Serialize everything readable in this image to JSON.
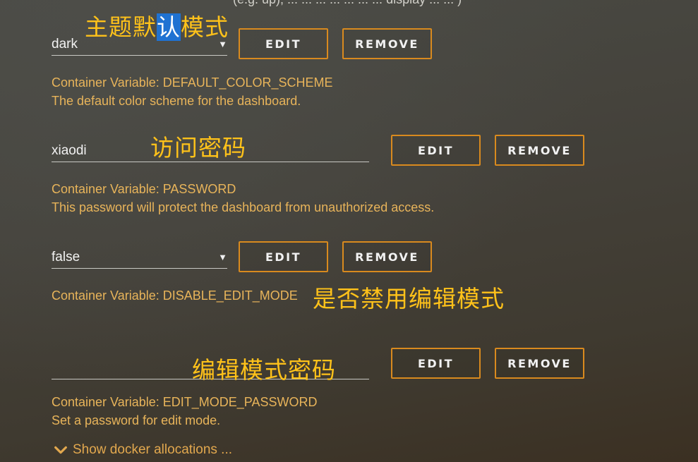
{
  "top_clipped_text": "(e.g. up), ... ... ... ... ... ... ... display ... ... )",
  "annotations": {
    "theme_prefix": "主题默",
    "theme_highlight": "认",
    "theme_suffix": "模式",
    "password": "访问密码",
    "disable_edit": "是否禁用编辑模式",
    "edit_password": "编辑模式密码"
  },
  "rows": [
    {
      "value": "dark",
      "caret": "▼",
      "edit_label": "EDIT",
      "remove_label": "REMOVE",
      "container_variable": "Container Variable: DEFAULT_COLOR_SCHEME",
      "description": "The default color scheme for the dashboard."
    },
    {
      "value": "xiaodi",
      "edit_label": "EDIT",
      "remove_label": "REMOVE",
      "container_variable": "Container Variable: PASSWORD",
      "description": "This password will protect the dashboard from unauthorized access."
    },
    {
      "value": "false",
      "caret": "▼",
      "edit_label": "EDIT",
      "remove_label": "REMOVE",
      "container_variable": "Container Variable: DISABLE_EDIT_MODE"
    },
    {
      "value": "",
      "edit_label": "EDIT",
      "remove_label": "REMOVE",
      "container_variable": "Container Variable: EDIT_MODE_PASSWORD",
      "description": "Set a password for edit mode."
    }
  ],
  "show_allocations": "Show docker allocations ...",
  "colors": {
    "accent": "#d98a1e",
    "note": "#e8b45a",
    "annotation": "#ffc21a",
    "highlight": "#1f72d2"
  }
}
